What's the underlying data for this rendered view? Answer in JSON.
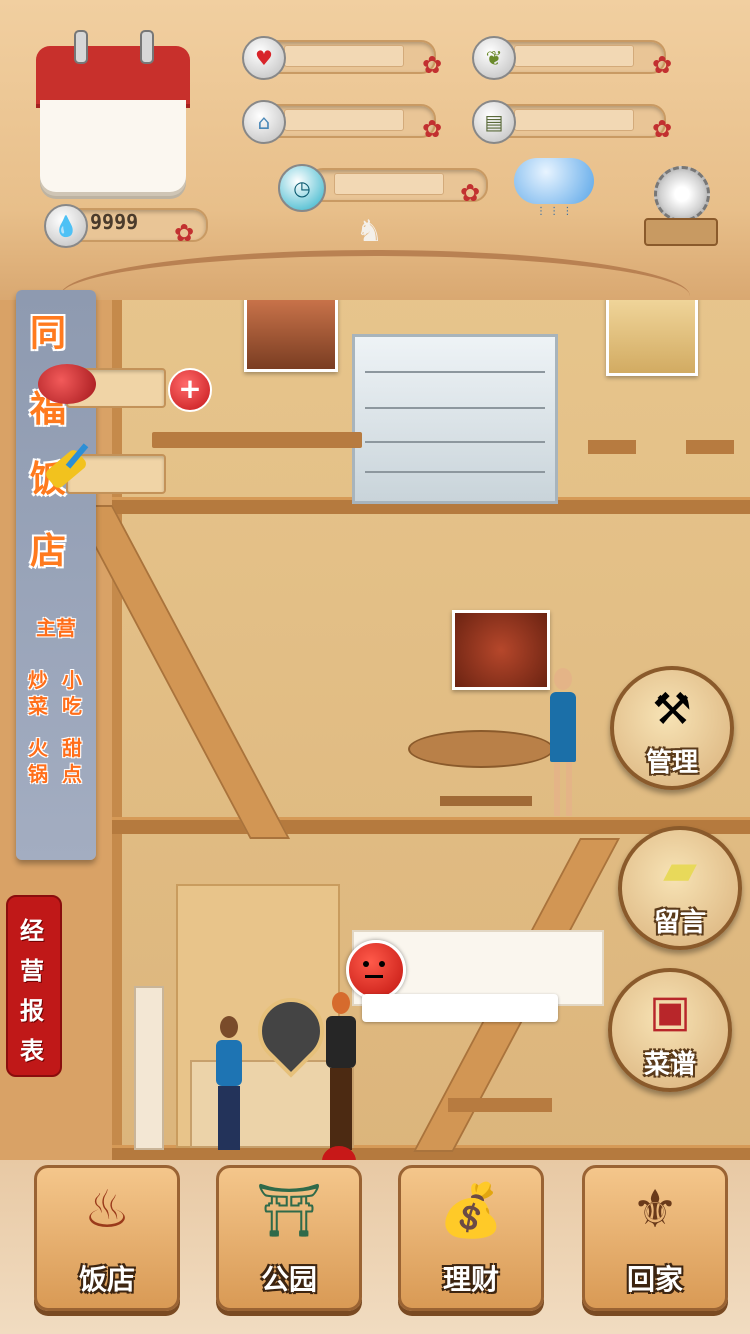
{
  "header": {
    "coins_value": "9999",
    "stats": [
      {
        "icon": "heart-icon",
        "value": ""
      },
      {
        "icon": "leaf-icon",
        "value": ""
      },
      {
        "icon": "house-icon",
        "value": ""
      },
      {
        "icon": "money-icon",
        "value": ""
      },
      {
        "icon": "alarm-clock-icon",
        "value": ""
      }
    ],
    "weather": "rain-cloud-icon",
    "settings": "gear-icon"
  },
  "banner": {
    "title_chars": [
      "同",
      "福",
      "饭",
      "店"
    ],
    "main_label": "主营",
    "categories": [
      "炒",
      "菜",
      "小",
      "吃",
      "火",
      "锅",
      "甜",
      "点"
    ]
  },
  "report_button": {
    "chars": [
      "经",
      "营",
      "报",
      "表"
    ]
  },
  "side_buttons": {
    "manage": "管理",
    "message": "留言",
    "menu": "菜谱"
  },
  "dialog": {
    "text": ""
  },
  "bottom_nav": [
    {
      "label": "饭店",
      "icon": "hotpot-icon"
    },
    {
      "label": "公园",
      "icon": "pavilion-icon"
    },
    {
      "label": "理财",
      "icon": "money-bag-icon"
    },
    {
      "label": "回家",
      "icon": "rocking-chair-icon"
    }
  ],
  "colors": {
    "accent_red": "#c01818",
    "banner_text": "#ff7a1e",
    "wood": "#b57a3e"
  }
}
